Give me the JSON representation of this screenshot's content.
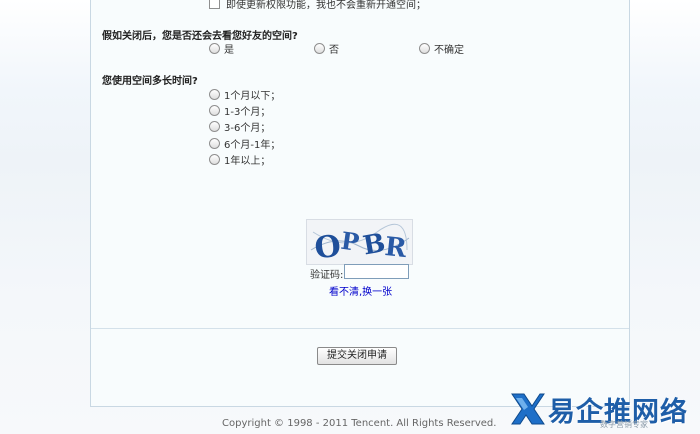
{
  "top_option": {
    "label": "即使更新权限功能，我也不会重新开通空间；"
  },
  "question_revisit": {
    "title": "假如关闭后，您是否还会去看您好友的空间?",
    "options": [
      "是",
      "否",
      "不确定"
    ]
  },
  "question_duration": {
    "title": "您使用空间多长时间?",
    "options": [
      "1个月以下；",
      "1-3个月；",
      "3-6个月；",
      "6个月-1年；",
      "1年以上；"
    ]
  },
  "captcha": {
    "image_text": "OPBR",
    "label": "验证码:",
    "input_value": "",
    "refresh_link": "看不清,换一张"
  },
  "submit_button": {
    "label": "提交关闭申请"
  },
  "footer": {
    "copyright": "Copyright © 1998 - 2011 Tencent. All Rights Reserved."
  },
  "watermark": {
    "text": "易企推网络",
    "sub": "数字营销专家"
  },
  "colors": {
    "link": "#0000cc",
    "panel_border": "#c9d8e3",
    "watermark": "#1e5ea8"
  }
}
